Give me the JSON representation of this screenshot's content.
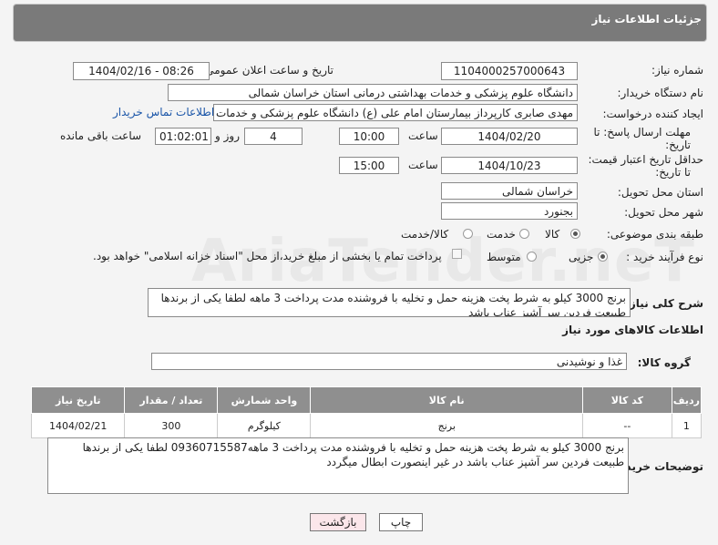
{
  "header": {
    "title": "جزئیات اطلاعات نیاز"
  },
  "form": {
    "need_number_label": "شماره نیاز:",
    "need_number": "1104000257000643",
    "announce_label": "تاریخ و ساعت اعلان عمومی:",
    "announce_value": "1404/02/16 - 08:26",
    "buyer_org_label": "نام دستگاه خریدار:",
    "buyer_org": "دانشگاه علوم پزشکی و خدمات بهداشتی درمانی استان خراسان شمالی",
    "requester_label": "ایجاد کننده درخواست:",
    "requester": "مهدی صابری کارپرداز بیمارستان امام علی (ع) دانشگاه علوم پزشکی و خدمات بهداشتی",
    "contact_link": "اطلاعات تماس خریدار",
    "deadline_label_1": "مهلت ارسال پاسخ: تا",
    "deadline_label_2": "تاریخ:",
    "deadline_date": "1404/02/20",
    "time_label": "ساعت",
    "deadline_time": "10:00",
    "days": "4",
    "days_label": "روز و",
    "remaining": "01:02:01",
    "remaining_label": "ساعت باقی مانده",
    "validity_label_1": "حداقل تاریخ اعتبار قیمت:",
    "validity_label_2": "تا تاریخ:",
    "validity_date": "1404/10/23",
    "validity_time": "15:00",
    "province_label": "استان محل تحویل:",
    "province": "خراسان شمالی",
    "city_label": "شهر محل تحویل:",
    "city": "بجنورد",
    "category_label": "طبقه بندی موضوعی:",
    "category_options": [
      "کالا",
      "خدمت",
      "کالا/خدمت"
    ],
    "category_selected": "کالا",
    "process_label": "نوع فرآیند خرید :",
    "process_options": [
      "جزیی",
      "متوسط"
    ],
    "process_selected": "جزیی",
    "payment_note": "پرداخت تمام یا بخشی از مبلغ خرید،از محل \"اسناد خزانه اسلامی\" خواهد بود.",
    "general_desc_label": "شرح کلی نیاز:",
    "general_desc": "برنج 3000 کیلو به شرط پخت هزینه حمل و تخلیه با فروشنده مدت پرداخت 3 ماهه لطفا یکی از  برندها طبیعت فردین سر آشپز  عناب  باشد",
    "items_section_title": "اطلاعات کالاهای مورد نیاز",
    "goods_group_label": "گروه کالا:",
    "goods_group": "غذا و نوشیدنی"
  },
  "table": {
    "columns": [
      "ردیف",
      "کد کالا",
      "نام کالا",
      "واحد شمارش",
      "تعداد / مقدار",
      "تاریخ نیاز"
    ],
    "rows": [
      [
        "1",
        "--",
        "برنج",
        "کیلوگرم",
        "300",
        "1404/02/21"
      ]
    ]
  },
  "buyer_notes_label": "توضیحات خریدار:",
  "buyer_notes": "برنج 3000 کیلو به شرط پخت هزینه حمل و تخلیه با فروشنده مدت پرداخت 3 ماهه09360715587 لطفا یکی از  برندها طبیعت فردین سر آشپز  عناب  باشد  در غیر اینصورت ابطال میگردد",
  "buttons": {
    "print": "چاپ",
    "back": "بازگشت"
  },
  "watermark": "AriaTender.neT"
}
